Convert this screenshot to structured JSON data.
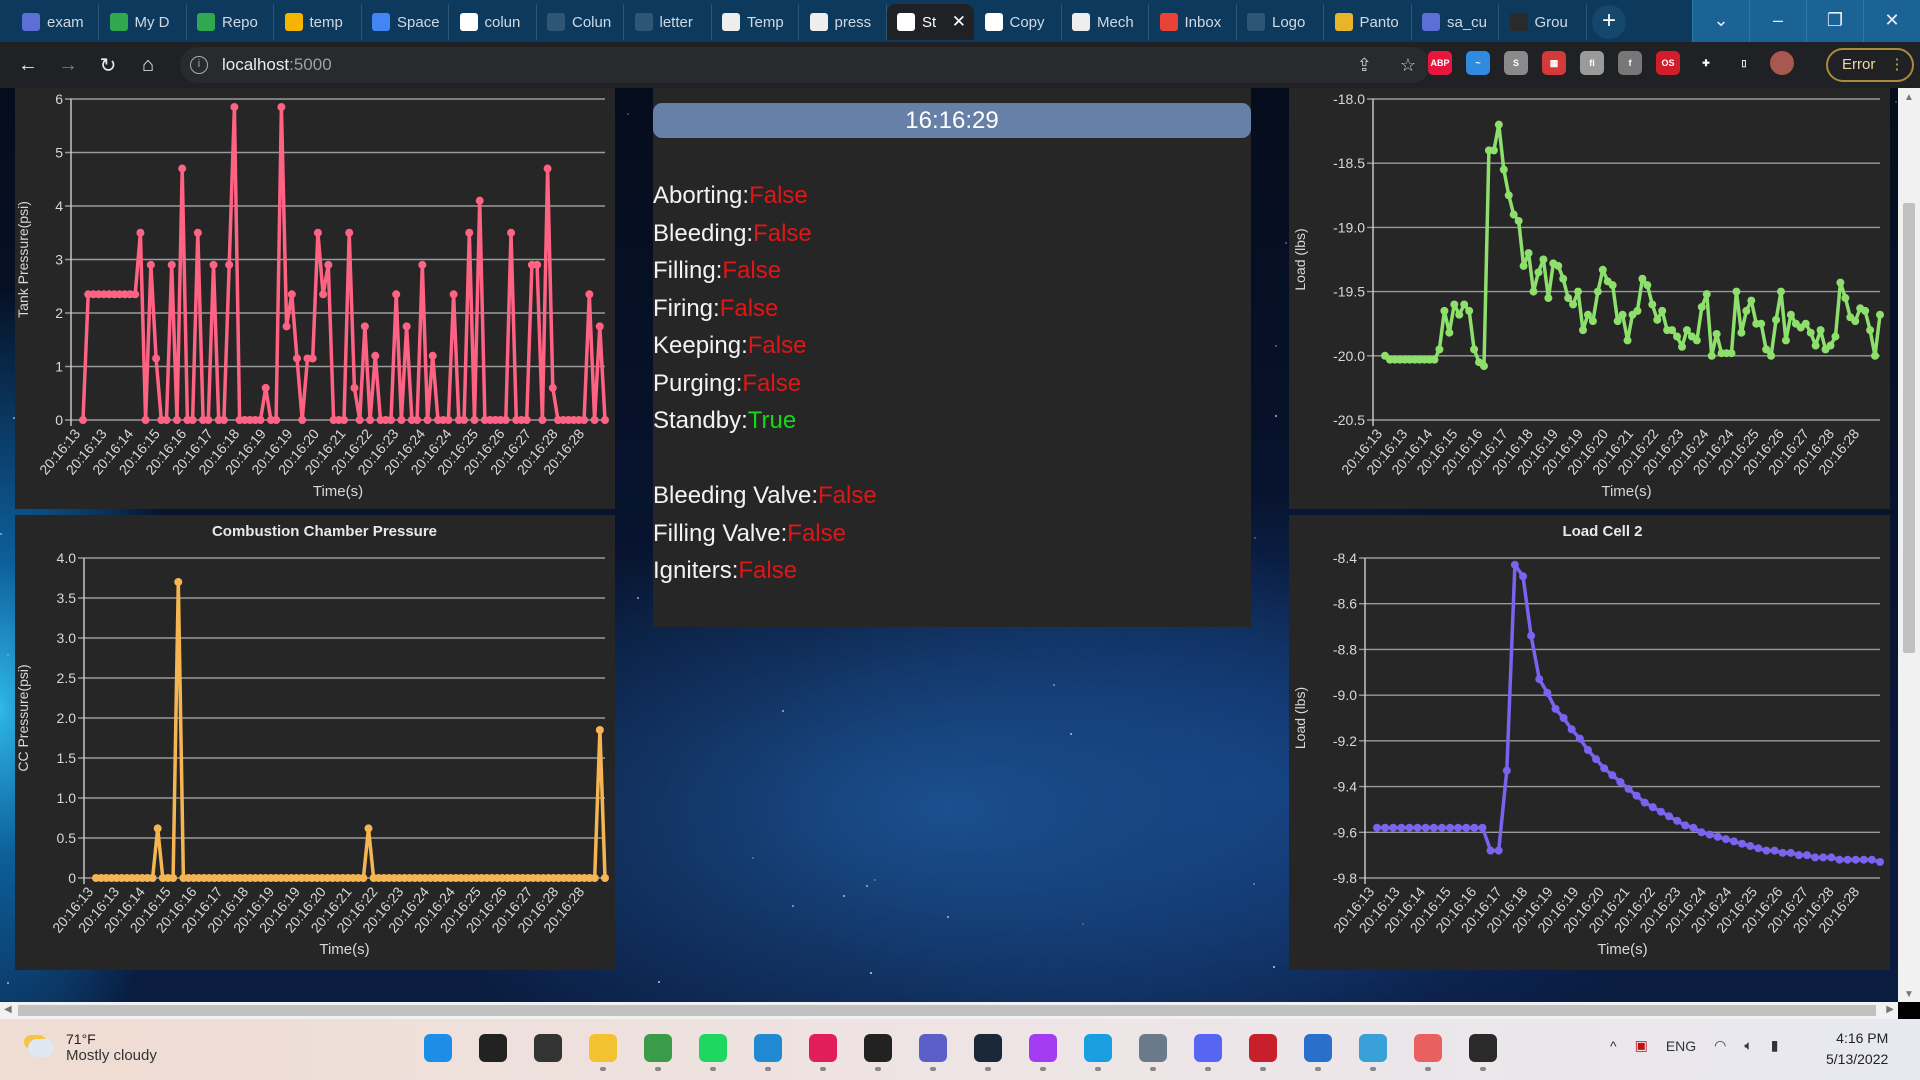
{
  "browser": {
    "tabs": [
      {
        "label": "exam",
        "icon": "image-icon",
        "color": "#5b6fd6"
      },
      {
        "label": "My D",
        "icon": "google-drive-icon",
        "color": "#2fa84f"
      },
      {
        "label": "Repo",
        "icon": "google-drive-icon",
        "color": "#2fa84f"
      },
      {
        "label": "temp",
        "icon": "google-slides-icon",
        "color": "#f4b400"
      },
      {
        "label": "Space",
        "icon": "google-docs-icon",
        "color": "#4285f4"
      },
      {
        "label": "colun",
        "icon": "google-icon",
        "color": "#ffffff"
      },
      {
        "label": "Colun",
        "icon": "crown-icon",
        "color": "#2c5576"
      },
      {
        "label": "letter",
        "icon": "crown-icon",
        "color": "#2c5576"
      },
      {
        "label": "Temp",
        "icon": "wpi-icon",
        "color": "#eeeeee"
      },
      {
        "label": "press",
        "icon": "wpi-icon",
        "color": "#eeeeee"
      },
      {
        "label": "St",
        "icon": "globe-icon",
        "color": "#ffffff",
        "active": true
      },
      {
        "label": "Copy",
        "icon": "google-icon",
        "color": "#ffffff"
      },
      {
        "label": "Mech",
        "icon": "wpi-icon",
        "color": "#eeeeee"
      },
      {
        "label": "Inbox",
        "icon": "gmail-icon",
        "color": "#ea4335"
      },
      {
        "label": "Logo",
        "icon": "crown-icon",
        "color": "#2c5576"
      },
      {
        "label": "Panto",
        "icon": "pantone-icon",
        "color": "#e8b52a"
      },
      {
        "label": "sa_cu",
        "icon": "image-icon",
        "color": "#5b6fd6"
      },
      {
        "label": "Grou",
        "icon": "github-icon",
        "color": "#2a2a2a"
      }
    ],
    "close_glyph": "✕",
    "new_tab": "+",
    "window_controls": [
      "⌄",
      "–",
      "❐",
      "✕"
    ],
    "url_host": "localhost",
    "url_port": ":5000",
    "extensions": [
      {
        "name": "adblock-icon",
        "label": "ABP",
        "color": "#e8163c"
      },
      {
        "name": "pulse-icon",
        "label": "~",
        "color": "#2f8be0"
      },
      {
        "name": "s-extension-icon",
        "label": "S",
        "color": "#8a8a8a"
      },
      {
        "name": "red-extension-icon",
        "label": "▦",
        "color": "#d43a3a"
      },
      {
        "name": "font-extension-icon",
        "label": "fi",
        "color": "#9a9a9a"
      },
      {
        "name": "facebook-icon",
        "label": "f",
        "color": "#777777"
      },
      {
        "name": "os-extension-icon",
        "label": "OS",
        "color": "#d01f2a"
      },
      {
        "name": "puzzle-icon",
        "label": "✚",
        "color": "#202124"
      },
      {
        "name": "sidepanel-icon",
        "label": "▯",
        "color": "#202124"
      },
      {
        "name": "avatar",
        "label": "",
        "color": "#a8584e"
      }
    ],
    "error_label": "Error"
  },
  "status": {
    "time": "16:16:29",
    "states": [
      {
        "label": "Aborting:",
        "value": "False"
      },
      {
        "label": "Bleeding:",
        "value": "False"
      },
      {
        "label": "Filling:",
        "value": "False"
      },
      {
        "label": "Firing:",
        "value": "False"
      },
      {
        "label": "Keeping:",
        "value": "False"
      },
      {
        "label": "Purging:",
        "value": "False"
      },
      {
        "label": "Standby:",
        "value": "True"
      }
    ],
    "valves": [
      {
        "label": "Bleeding Valve:",
        "value": "False"
      },
      {
        "label": "Filling Valve:",
        "value": "False"
      },
      {
        "label": "Igniters:",
        "value": "False"
      }
    ],
    "colors": {
      "false": "#e01616",
      "true": "#17d817"
    }
  },
  "chart_data": [
    {
      "id": "tank",
      "type": "line",
      "title": "",
      "xlabel": "Time(s)",
      "ylabel": "Tank Pressure(psi)",
      "ylim": [
        0,
        6
      ],
      "yticks": [
        0,
        1,
        2,
        3,
        4,
        5,
        6
      ],
      "ytick_labels": [
        "0",
        "1",
        "2",
        "3",
        "4",
        "5",
        "6"
      ],
      "color": "#ff6384",
      "grid": true,
      "categories": [
        "20:16:13",
        "20:16:13",
        "20:16:14",
        "20:16:15",
        "20:16:16",
        "20:16:17",
        "20:16:18",
        "20:16:19",
        "20:16:19",
        "20:16:20",
        "20:16:21",
        "20:16:22",
        "20:16:23",
        "20:16:24",
        "20:16:24",
        "20:16:25",
        "20:16:26",
        "20:16:27",
        "20:16:28",
        "20:16:28"
      ],
      "values": [
        0,
        2.35,
        2.35,
        2.35,
        2.35,
        2.35,
        2.35,
        2.35,
        2.35,
        2.35,
        2.35,
        3.5,
        0,
        2.9,
        1.15,
        0,
        0,
        2.9,
        0,
        4.7,
        0,
        0,
        3.5,
        0,
        0,
        2.9,
        0,
        0,
        2.9,
        5.85,
        0,
        0,
        0,
        0,
        0,
        0.6,
        0,
        0,
        5.85,
        1.75,
        2.35,
        1.15,
        0,
        1.15,
        1.15,
        3.5,
        2.35,
        2.9,
        0,
        0,
        0,
        3.5,
        0.6,
        0,
        1.75,
        0,
        1.2,
        0,
        0,
        0,
        2.35,
        0,
        1.75,
        0,
        0,
        2.9,
        0,
        1.2,
        0,
        0,
        0,
        2.35,
        0,
        0,
        3.5,
        0,
        4.1,
        0,
        0,
        0,
        0,
        0,
        3.5,
        0,
        0,
        0,
        2.9,
        2.9,
        0,
        4.7,
        0.6,
        0,
        0,
        0,
        0,
        0,
        0,
        2.35,
        0,
        1.75,
        0
      ]
    },
    {
      "id": "lc1",
      "type": "line",
      "title": "",
      "xlabel": "Time(s)",
      "ylabel": "Load (lbs)",
      "ylim": [
        -20.5,
        -18.0
      ],
      "yticks": [
        -20.5,
        -20.0,
        -19.5,
        -19.0,
        -18.5,
        -18.0
      ],
      "ytick_labels": [
        "-20.5",
        "-20.0",
        "-19.5",
        "-19.0",
        "-18.5",
        "-18.0"
      ],
      "color": "#8ee06c",
      "grid": true,
      "categories": [
        "20:16:13",
        "20:16:13",
        "20:16:14",
        "20:16:15",
        "20:16:16",
        "20:16:17",
        "20:16:18",
        "20:16:19",
        "20:16:19",
        "20:16:20",
        "20:16:21",
        "20:16:22",
        "20:16:23",
        "20:16:24",
        "20:16:24",
        "20:16:25",
        "20:16:26",
        "20:16:27",
        "20:16:28",
        "20:16:28"
      ],
      "values": [
        -20.0,
        -20.03,
        -20.03,
        -20.03,
        -20.03,
        -20.03,
        -20.03,
        -20.03,
        -20.03,
        -20.03,
        -20.03,
        -19.95,
        -19.65,
        -19.82,
        -19.6,
        -19.68,
        -19.6,
        -19.65,
        -19.95,
        -20.05,
        -20.08,
        -18.4,
        -18.4,
        -18.2,
        -18.55,
        -18.75,
        -18.9,
        -18.95,
        -19.3,
        -19.2,
        -19.5,
        -19.35,
        -19.25,
        -19.55,
        -19.28,
        -19.3,
        -19.4,
        -19.55,
        -19.6,
        -19.5,
        -19.8,
        -19.68,
        -19.73,
        -19.5,
        -19.33,
        -19.42,
        -19.45,
        -19.73,
        -19.68,
        -19.88,
        -19.68,
        -19.65,
        -19.4,
        -19.45,
        -19.6,
        -19.72,
        -19.65,
        -19.8,
        -19.8,
        -19.85,
        -19.93,
        -19.8,
        -19.85,
        -19.88,
        -19.62,
        -19.52,
        -20.0,
        -19.83,
        -19.98,
        -19.98,
        -19.98,
        -19.5,
        -19.82,
        -19.65,
        -19.57,
        -19.75,
        -19.75,
        -19.95,
        -20.0,
        -19.72,
        -19.5,
        -19.88,
        -19.68,
        -19.75,
        -19.78,
        -19.75,
        -19.82,
        -19.92,
        -19.8,
        -19.95,
        -19.92,
        -19.85,
        -19.43,
        -19.55,
        -19.7,
        -19.73,
        -19.63,
        -19.65,
        -19.8,
        -20.0,
        -19.68
      ]
    },
    {
      "id": "cc",
      "type": "line",
      "title": "Combustion Chamber Pressure",
      "xlabel": "Time(s)",
      "ylabel": "CC Pressure(psi)",
      "ylim": [
        0,
        4.0
      ],
      "yticks": [
        0,
        0.5,
        1.0,
        1.5,
        2.0,
        2.5,
        3.0,
        3.5,
        4.0
      ],
      "ytick_labels": [
        "0",
        "0.5",
        "1.0",
        "1.5",
        "2.0",
        "2.5",
        "3.0",
        "3.5",
        "4.0"
      ],
      "color": "#f5b553",
      "grid": true,
      "categories": [
        "20:16:13",
        "20:16:13",
        "20:16:14",
        "20:16:15",
        "20:16:16",
        "20:16:17",
        "20:16:18",
        "20:16:19",
        "20:16:19",
        "20:16:20",
        "20:16:21",
        "20:16:22",
        "20:16:23",
        "20:16:24",
        "20:16:24",
        "20:16:25",
        "20:16:26",
        "20:16:27",
        "20:16:28",
        "20:16:28"
      ],
      "values": [
        0,
        0,
        0,
        0,
        0,
        0,
        0,
        0,
        0,
        0,
        0,
        0,
        0.62,
        0,
        0,
        0,
        3.7,
        0,
        0,
        0,
        0,
        0,
        0,
        0,
        0,
        0,
        0,
        0,
        0,
        0,
        0,
        0,
        0,
        0,
        0,
        0,
        0,
        0,
        0,
        0,
        0,
        0,
        0,
        0,
        0,
        0,
        0,
        0,
        0,
        0,
        0,
        0,
        0,
        0.62,
        0,
        0,
        0,
        0,
        0,
        0,
        0,
        0,
        0,
        0,
        0,
        0,
        0,
        0,
        0,
        0,
        0,
        0,
        0,
        0,
        0,
        0,
        0,
        0,
        0,
        0,
        0,
        0,
        0,
        0,
        0,
        0,
        0,
        0,
        0,
        0,
        0,
        0,
        0,
        0,
        0,
        0,
        0,
        0,
        1.85,
        0
      ]
    },
    {
      "id": "lc2",
      "type": "line",
      "title": "Load Cell 2",
      "xlabel": "Time(s)",
      "ylabel": "Load (lbs)",
      "ylim": [
        -9.8,
        -8.4
      ],
      "yticks": [
        -9.8,
        -9.6,
        -9.4,
        -9.2,
        -9.0,
        -8.8,
        -8.6,
        -8.4
      ],
      "ytick_labels": [
        "-9.8",
        "-9.6",
        "-9.4",
        "-9.2",
        "-9.0",
        "-8.8",
        "-8.6",
        "-8.4"
      ],
      "color": "#7b63f0",
      "grid": true,
      "categories": [
        "20:16:13",
        "20:16:13",
        "20:16:14",
        "20:16:15",
        "20:16:16",
        "20:16:17",
        "20:16:18",
        "20:16:19",
        "20:16:19",
        "20:16:20",
        "20:16:21",
        "20:16:22",
        "20:16:23",
        "20:16:24",
        "20:16:24",
        "20:16:25",
        "20:16:26",
        "20:16:27",
        "20:16:28",
        "20:16:28"
      ],
      "values": [
        -9.58,
        -9.58,
        -9.58,
        -9.58,
        -9.58,
        -9.58,
        -9.58,
        -9.58,
        -9.58,
        -9.58,
        -9.58,
        -9.58,
        -9.58,
        -9.58,
        -9.68,
        -9.68,
        -9.33,
        -8.43,
        -8.48,
        -8.74,
        -8.93,
        -8.99,
        -9.06,
        -9.1,
        -9.15,
        -9.19,
        -9.24,
        -9.28,
        -9.32,
        -9.35,
        -9.38,
        -9.41,
        -9.44,
        -9.47,
        -9.49,
        -9.51,
        -9.53,
        -9.55,
        -9.57,
        -9.58,
        -9.6,
        -9.61,
        -9.62,
        -9.63,
        -9.64,
        -9.65,
        -9.66,
        -9.67,
        -9.68,
        -9.68,
        -9.69,
        -9.69,
        -9.7,
        -9.7,
        -9.71,
        -9.71,
        -9.71,
        -9.72,
        -9.72,
        -9.72,
        -9.72,
        -9.72,
        -9.73
      ]
    }
  ],
  "taskbar": {
    "weather_temp": "71°F",
    "weather_desc": "Mostly cloudy",
    "apps": [
      {
        "name": "windows-start-icon",
        "color": "#1d8ee8"
      },
      {
        "name": "search-icon",
        "color": "#222222"
      },
      {
        "name": "task-view-icon",
        "color": "#333333"
      },
      {
        "name": "file-explorer-icon",
        "color": "#f2c230"
      },
      {
        "name": "chrome-icon",
        "color": "#3a9b4b"
      },
      {
        "name": "spotify-icon",
        "color": "#1ed760"
      },
      {
        "name": "vscode-icon",
        "color": "#1f8ad2"
      },
      {
        "name": "slack-icon",
        "color": "#e01e5a"
      },
      {
        "name": "sticky-notes-icon",
        "color": "#222222"
      },
      {
        "name": "teams-icon",
        "color": "#5b5fc7"
      },
      {
        "name": "steam-icon",
        "color": "#1b2838"
      },
      {
        "name": "messenger-icon",
        "color": "#a33bf0"
      },
      {
        "name": "edge-icon",
        "color": "#1b9de2"
      },
      {
        "name": "settings-icon",
        "color": "#6b7a8a"
      },
      {
        "name": "discord-icon",
        "color": "#5865f2"
      },
      {
        "name": "solidworks-icon",
        "color": "#c8202a"
      },
      {
        "name": "powershell-icon",
        "color": "#2a6fc9"
      },
      {
        "name": "notepad-icon",
        "color": "#3aa0d8"
      },
      {
        "name": "snipping-tool-icon",
        "color": "#e86060"
      },
      {
        "name": "obs-icon",
        "color": "#2a2a2a"
      }
    ],
    "tray_chevron": "^",
    "language": "ENG",
    "time": "4:16 PM",
    "date": "5/13/2022"
  }
}
